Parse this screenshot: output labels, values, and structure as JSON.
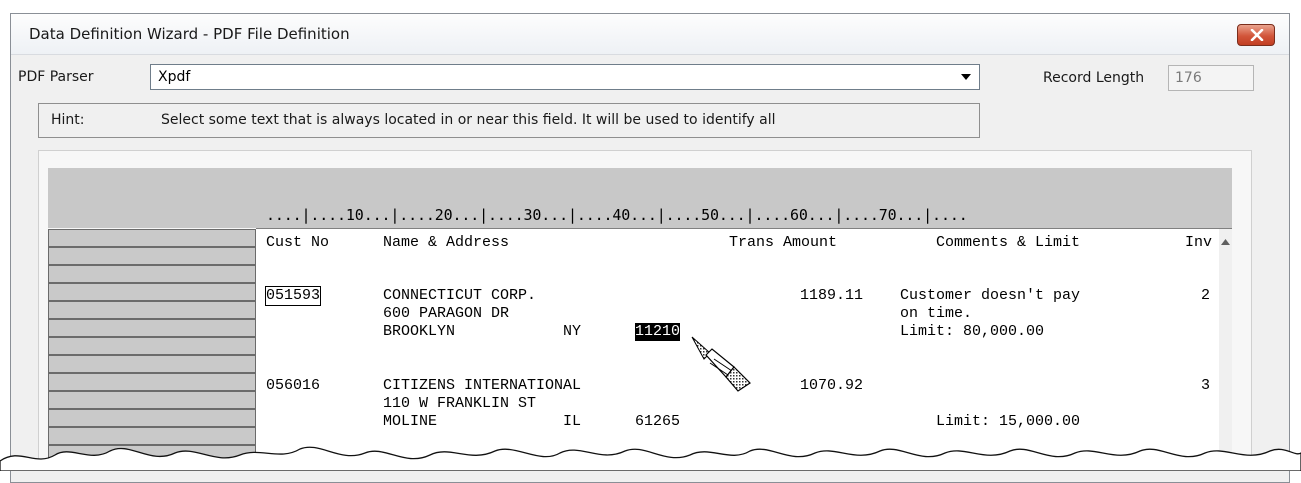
{
  "window": {
    "title": "Data Definition Wizard - PDF File Definition",
    "close_icon": "close-icon"
  },
  "parser": {
    "label": "PDF Parser",
    "value": "Xpdf"
  },
  "record_length": {
    "label": "Record Length",
    "value": "176"
  },
  "hint": {
    "label": "Hint:",
    "text": "Select some text that is always located in or near this field.  It will be used to identify all"
  },
  "ruler": "....|....10...|....20...|....30...|....40...|....50...|....60...|....70...|....",
  "header": {
    "cust_no": "Cust No",
    "name_address": "Name & Address",
    "trans_amount": "Trans Amount",
    "comments_limit": "Comments & Limit",
    "inv": "Inv"
  },
  "records": [
    {
      "cust_no": "051593",
      "name": "CONNECTICUT CORP.",
      "amount": "1189.11",
      "comment1": "Customer doesn't pay",
      "inv": "2",
      "street": "600 PARAGON DR",
      "comment2": "on time.",
      "city": "BROOKLYN",
      "state": "NY",
      "zip": "11210",
      "limit": "Limit: 80,000.00"
    },
    {
      "cust_no": "056016",
      "name": "CITIZENS INTERNATIONAL",
      "amount": "1070.92",
      "inv": "3",
      "street": "110 W FRANKLIN ST",
      "city": "MOLINE",
      "state": "IL",
      "zip": "61265",
      "limit": "Limit: 15,000.00"
    }
  ],
  "colors": {
    "close_button": "#c84a2e",
    "selection": "#000000",
    "ruler_band": "#c8c8c8"
  }
}
